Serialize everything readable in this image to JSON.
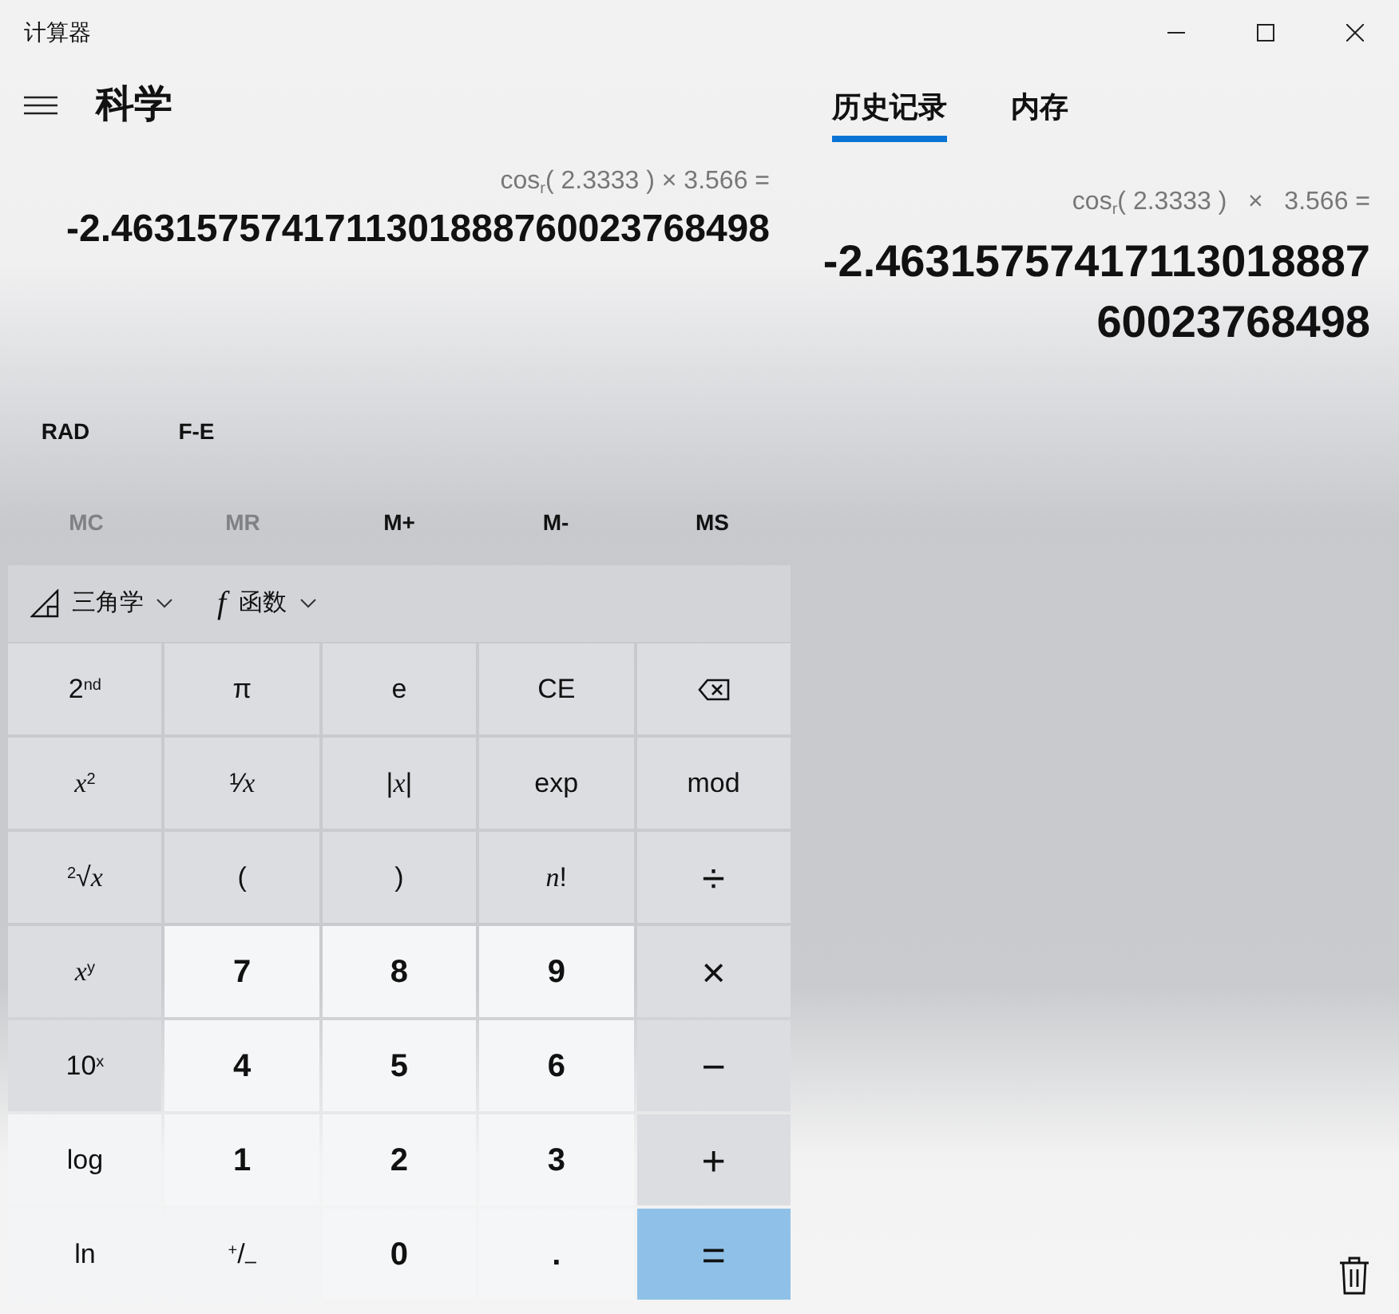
{
  "window": {
    "title": "计算器"
  },
  "mode": {
    "title": "科学"
  },
  "display": {
    "expression": "cos$_{r}$( 2.3333 ) × 3.566 =",
    "result": "-2.4631575741711301888760023768498"
  },
  "toggles": [
    "RAD",
    "F-E"
  ],
  "memory": [
    {
      "label": "MC",
      "disabled": true
    },
    {
      "label": "MR",
      "disabled": true
    },
    {
      "label": "M+",
      "disabled": false
    },
    {
      "label": "M-",
      "disabled": false
    },
    {
      "label": "MS",
      "disabled": false
    }
  ],
  "menus": [
    {
      "kind": "trig",
      "label": "三角学"
    },
    {
      "kind": "func",
      "icon": "f",
      "label": "函数"
    }
  ],
  "keys": [
    {
      "kind": "fn",
      "label": "2$^{nd}$"
    },
    {
      "kind": "fn",
      "label": "π"
    },
    {
      "kind": "fn",
      "label": "e"
    },
    {
      "kind": "fn",
      "label": "CE"
    },
    {
      "kind": "backspace"
    },
    {
      "kind": "fn",
      "label": "*x*$^{2}$"
    },
    {
      "kind": "fn",
      "label": "¹⁄*x*"
    },
    {
      "kind": "fn",
      "label": "|*x*|"
    },
    {
      "kind": "fn",
      "label": "exp"
    },
    {
      "kind": "fn",
      "label": "mod"
    },
    {
      "kind": "fn",
      "label": "$^{2}$√*x*"
    },
    {
      "kind": "fn",
      "label": "("
    },
    {
      "kind": "fn",
      "label": ")"
    },
    {
      "kind": "fn",
      "label": "*n*!"
    },
    {
      "kind": "op",
      "label": "÷"
    },
    {
      "kind": "fn",
      "label": "*x*$^{y}$"
    },
    {
      "kind": "digit",
      "label": "7"
    },
    {
      "kind": "digit",
      "label": "8"
    },
    {
      "kind": "digit",
      "label": "9"
    },
    {
      "kind": "op",
      "label": "×"
    },
    {
      "kind": "fn",
      "label": "10$^{x}$"
    },
    {
      "kind": "digit",
      "label": "4"
    },
    {
      "kind": "digit",
      "label": "5"
    },
    {
      "kind": "digit",
      "label": "6"
    },
    {
      "kind": "op",
      "label": "−"
    },
    {
      "kind": "light",
      "label": "log"
    },
    {
      "kind": "digit",
      "label": "1"
    },
    {
      "kind": "digit",
      "label": "2"
    },
    {
      "kind": "digit",
      "label": "3"
    },
    {
      "kind": "op",
      "label": "+"
    },
    {
      "kind": "light",
      "label": "ln"
    },
    {
      "kind": "light",
      "label": "$^{+}$/$_{–}$"
    },
    {
      "kind": "digit",
      "label": "0"
    },
    {
      "kind": "digit",
      "label": "."
    },
    {
      "kind": "equals",
      "label": "="
    }
  ],
  "tabs": [
    {
      "label": "历史记录",
      "selected": true
    },
    {
      "label": "内存",
      "selected": false
    }
  ],
  "history": [
    {
      "expression": "cos$_{r}$( 2.3333 )   ×   3.566 =",
      "result": "-2.4631575741711301888760023768498"
    }
  ]
}
